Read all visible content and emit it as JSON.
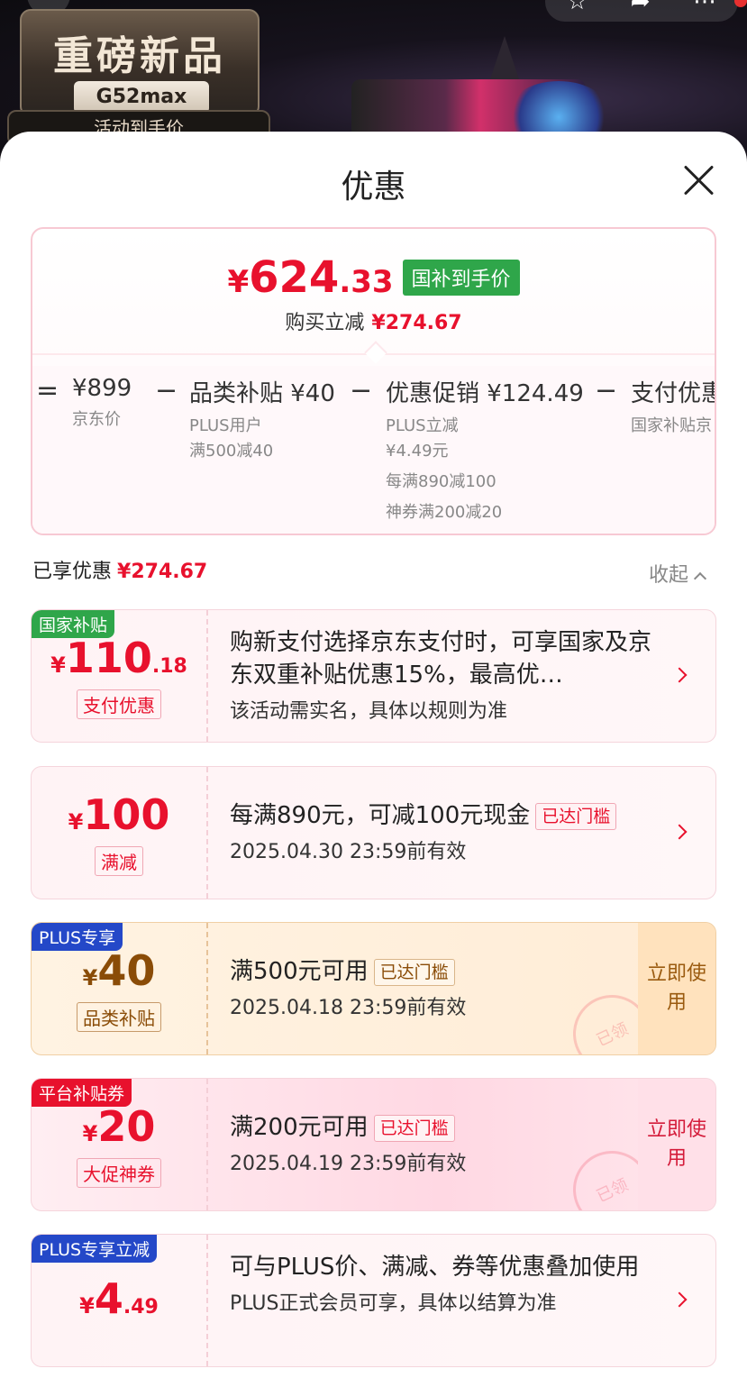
{
  "background": {
    "badge_title": "重磅新品",
    "badge_model": "G52max",
    "badge_sub": "活动到手价"
  },
  "sheet": {
    "title": "优惠"
  },
  "summary": {
    "price_yen": "¥",
    "price_int": "624",
    "price_dec": ".33",
    "price_tag": "国补到手价",
    "buy_label": "购买立减",
    "buy_amount": "¥274.67",
    "breakdown": [
      {
        "op": "=",
        "title": "¥899",
        "lines": [
          "京东价"
        ]
      },
      {
        "op": "−",
        "title": "品类补贴 ¥40",
        "lines": [
          "PLUS用户",
          "满500减40"
        ]
      },
      {
        "op": "−",
        "title": "优惠促销 ¥124.49",
        "lines": [
          "PLUS立减",
          "¥4.49元",
          "每满890减100",
          "神券满200减20"
        ]
      },
      {
        "op": "−",
        "title": "支付优惠",
        "lines": [
          "国家补贴京"
        ]
      }
    ]
  },
  "enjoyed": {
    "label": "已享优惠",
    "amount": "¥274.67",
    "collapse": "收起"
  },
  "coupons": [
    {
      "tag": "国家补贴",
      "tag_color": "#2fa64a",
      "yen": "¥",
      "num": "110",
      "dec": ".18",
      "label": "支付优惠",
      "desc": "购新支付选择京东支付时，可享国家及京东双重补贴优惠15%，最高优…",
      "sub": "该活动需实名，具体以规则为准"
    },
    {
      "tag": "",
      "yen": "¥",
      "num": "100",
      "dec": "",
      "label": "满减",
      "desc": "每满890元，可减100元现金",
      "chip": "已达门槛",
      "sub": "2025.04.30 23:59前有效"
    },
    {
      "tag": "PLUS专享",
      "tag_color": "#2448c8",
      "yen": "¥",
      "num": "40",
      "dec": "",
      "label": "品类补贴",
      "desc": "满500元可用",
      "chip": "已达门槛",
      "sub": "2025.04.18 23:59前有效",
      "action": "立即使用",
      "stamp": "已领"
    },
    {
      "tag": "平台补贴券",
      "tag_color": "#e8112d",
      "yen": "¥",
      "num": "20",
      "dec": "",
      "label": "大促神券",
      "desc": "满200元可用",
      "chip": "已达门槛",
      "sub": "2025.04.19 23:59前有效",
      "action": "立即使用",
      "stamp": "已领"
    },
    {
      "tag": "PLUS专享立减",
      "tag_color": "#2448c8",
      "yen": "¥",
      "num": "4",
      "dec": ".49",
      "label": "",
      "desc": "可与PLUS价、满减、券等优惠叠加使用",
      "sub": "PLUS正式会员可享，具体以结算为准"
    }
  ]
}
